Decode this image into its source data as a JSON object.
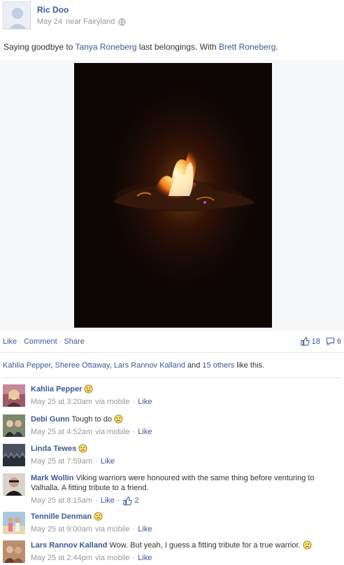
{
  "post": {
    "author": "Ric Doo",
    "date": "May 24",
    "location_prefix": "near",
    "location": "Fairyland",
    "text_before": "Saying goodbye to ",
    "tagged_person": "Tanya Roneberg",
    "text_middle": " last belongings. With ",
    "with_person": "Brett Roneberg",
    "text_end": "."
  },
  "actions": {
    "like": "Like",
    "comment": "Comment",
    "share": "Share",
    "like_count": "18",
    "comment_count": "6"
  },
  "likes": {
    "names": [
      "Kahlia Pepper",
      "Sheree Ottaway",
      "Lars Rannov Kalland"
    ],
    "others": "15 others",
    "suffix": " like this."
  },
  "comments": [
    {
      "name": "Kahlia Pepper",
      "text": "",
      "emoticon": true,
      "time": "May 25 at 3:20am",
      "via": "via mobile",
      "like": "Like",
      "likes": ""
    },
    {
      "name": "Debi Gunn",
      "text": "Tough to do",
      "emoticon": true,
      "time": "May 25 at 4:52am",
      "via": "via mobile",
      "like": "Like",
      "likes": ""
    },
    {
      "name": "Linda Tewes",
      "text": "",
      "emoticon": true,
      "time": "May 25 at 7:59am",
      "via": "",
      "like": "Like",
      "likes": ""
    },
    {
      "name": "Mark Wollin",
      "text": "Viking warriors were honoured with the same thing before venturing to Valhalla. A fitting tribute to a friend.",
      "emoticon": false,
      "time": "May 25 at 8:15am",
      "via": "",
      "like": "Like",
      "likes": "2"
    },
    {
      "name": "Tennille Denman",
      "text": "",
      "emoticon": true,
      "time": "May 25 at 9:00am",
      "via": "via mobile",
      "like": "Like",
      "likes": ""
    },
    {
      "name": "Lars Rannov Kalland",
      "text": "Wow. But yeah, I guess a fitting tribute for a true warrior.",
      "emoticon": true,
      "time": "May 25 at 2:44pm",
      "via": "via mobile",
      "like": "Like",
      "likes": ""
    }
  ]
}
